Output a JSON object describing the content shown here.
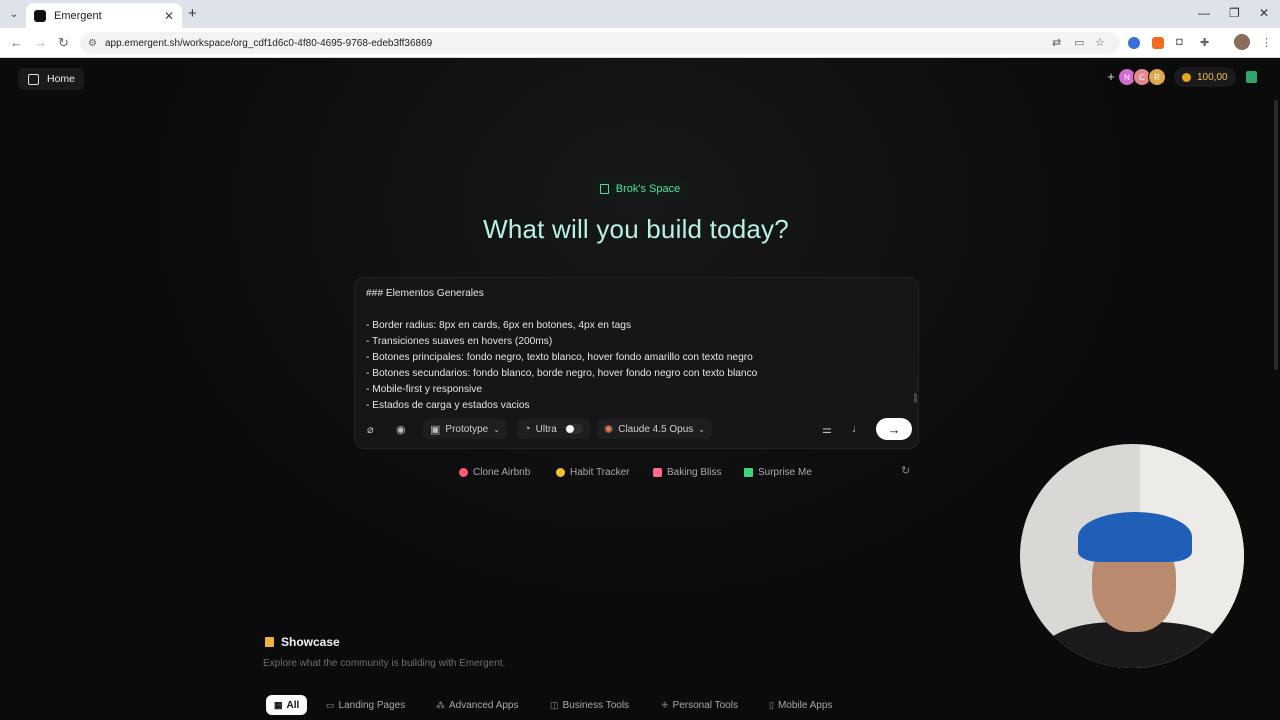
{
  "browser": {
    "tab_title": "Emergent",
    "url": "app.emergent.sh/workspace/org_cdf1d6c0-4f80-4695-9768-edeb3ff36869"
  },
  "header": {
    "home_label": "Home",
    "avatars": [
      {
        "initial": "N",
        "color": "#d46bd0"
      },
      {
        "initial": "C",
        "color": "#e48a8a"
      },
      {
        "initial": "R",
        "color": "#e0a84e"
      }
    ],
    "credits": "100,00"
  },
  "hero": {
    "space_label": "Brok's Space",
    "title": "What will you build today?"
  },
  "prompt": {
    "text": "### Elementos Generales\n\n- Border radius: 8px en cards, 6px en botones, 4px en tags\n- Transiciones suaves en hovers (200ms)\n- Botones principales: fondo negro, texto blanco, hover fondo amarillo con texto negro\n- Botones secundarios: fondo blanco, borde negro, hover fondo negro con texto blanco\n- Mobile-first y responsive\n- Estados de carga y estados vacios",
    "mode_label": "Prototype",
    "ultra_label": "Ultra",
    "model_label": "Claude 4.5 Opus"
  },
  "suggestions": [
    {
      "label": "Clone Airbnb",
      "color": "#ff5a6e"
    },
    {
      "label": "Habit Tracker",
      "color": "#f0c22a"
    },
    {
      "label": "Baking Bliss",
      "color": "#ff6b8a"
    },
    {
      "label": "Surprise Me",
      "color": "#3fd47e"
    }
  ],
  "showcase": {
    "title": "Showcase",
    "subtitle": "Explore what the community is building with Emergent.",
    "categories": [
      "All",
      "Landing Pages",
      "Advanced Apps",
      "Business Tools",
      "Personal Tools",
      "Mobile Apps"
    ]
  },
  "icons": {
    "home": "sidebar-icon",
    "space": "building-icon",
    "attach": "paperclip-icon",
    "github": "github-icon",
    "mode": "car-icon",
    "ultra": "dial-icon",
    "model": "sparkle-icon",
    "settings": "sliders-icon",
    "mic": "mic-icon",
    "send": "arrow-right-icon",
    "refresh": "refresh-icon"
  }
}
